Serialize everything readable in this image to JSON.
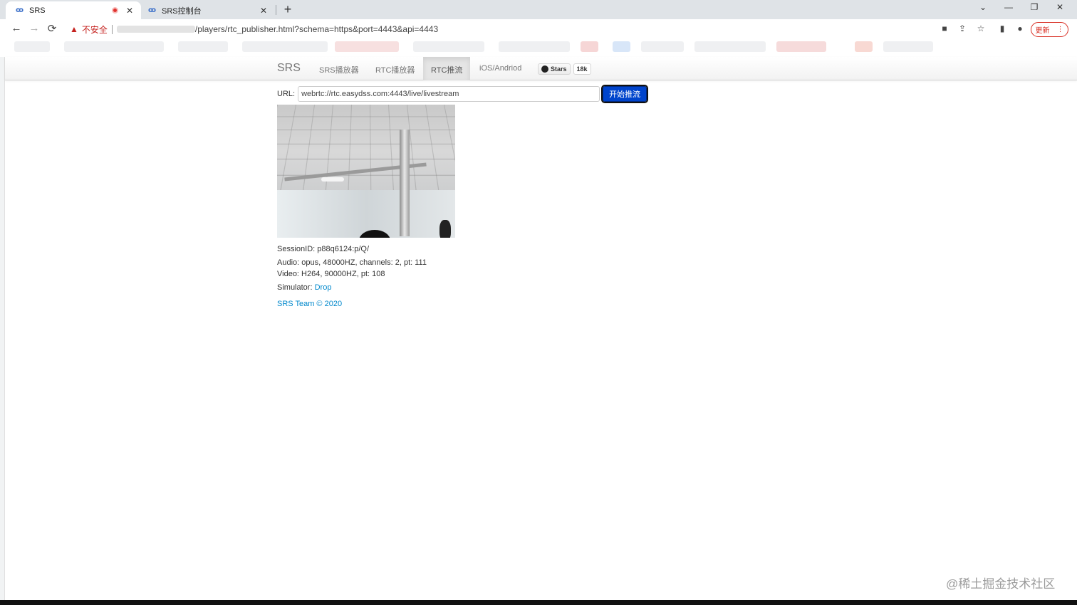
{
  "browser": {
    "tabs": [
      {
        "title": "SRS",
        "favicon": "srs-favicon",
        "recording": true
      },
      {
        "title": "SRS控制台",
        "favicon": "srs-favicon"
      }
    ],
    "address": {
      "security_label": "不安全",
      "url_path": "/players/rtc_publisher.html?schema=https&port=4443&api=4443"
    },
    "update_label": "更新",
    "icons": {
      "back": "←",
      "forward": "→",
      "reload": "⟳",
      "new_tab": "+",
      "minimize": "—",
      "restore": "❐",
      "close": "✕",
      "warning": "▲",
      "camera": "■",
      "share": "⇪",
      "star": "☆",
      "sidepanel": "▮",
      "profile": "●",
      "menu": "⋮",
      "tab_close": "✕",
      "tabs_dropdown": "⌄"
    }
  },
  "page": {
    "brand": "SRS",
    "nav": [
      {
        "label": "SRS播放器"
      },
      {
        "label": "RTC播放器"
      },
      {
        "label": "RTC推流",
        "active": true
      },
      {
        "label": "iOS/Andriod"
      }
    ],
    "github": {
      "label": "Stars",
      "count": "18k"
    },
    "url_label": "URL:",
    "url_value": "webrtc://rtc.easydss.com:4443/live/livestream",
    "start_button": "开始推流",
    "session": "SessionID: p88q6124:p/Q/",
    "audio": "Audio: opus, 48000HZ, channels: 2, pt: 111",
    "video": "Video: H264, 90000HZ, pt: 108",
    "simulator_label": "Simulator:",
    "simulator_link": "Drop",
    "footer": "SRS Team © 2020"
  },
  "watermark": "@稀土掘金技术社区"
}
